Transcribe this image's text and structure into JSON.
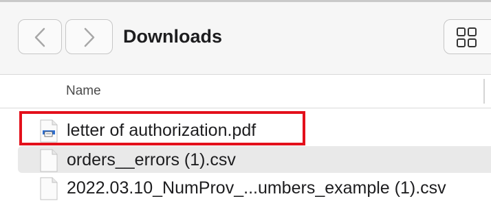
{
  "toolbar": {
    "title": "Downloads",
    "back_icon": "chevron-left-icon",
    "forward_icon": "chevron-right-icon",
    "view_icon": "grid-view-icon"
  },
  "list": {
    "column_name": "Name",
    "files": [
      {
        "name": "letter of authorization.pdf",
        "icon": "pdf-document-icon",
        "highlighted": true
      },
      {
        "name": "orders__errors (1).csv",
        "icon": "csv-document-icon",
        "highlighted": false
      },
      {
        "name": "2022.03.10_NumProv_...umbers_example (1).csv",
        "icon": "csv-document-icon",
        "highlighted": false
      }
    ]
  },
  "colors": {
    "annotation": "#e3101b",
    "alternate_row": "#e9e9e9"
  }
}
